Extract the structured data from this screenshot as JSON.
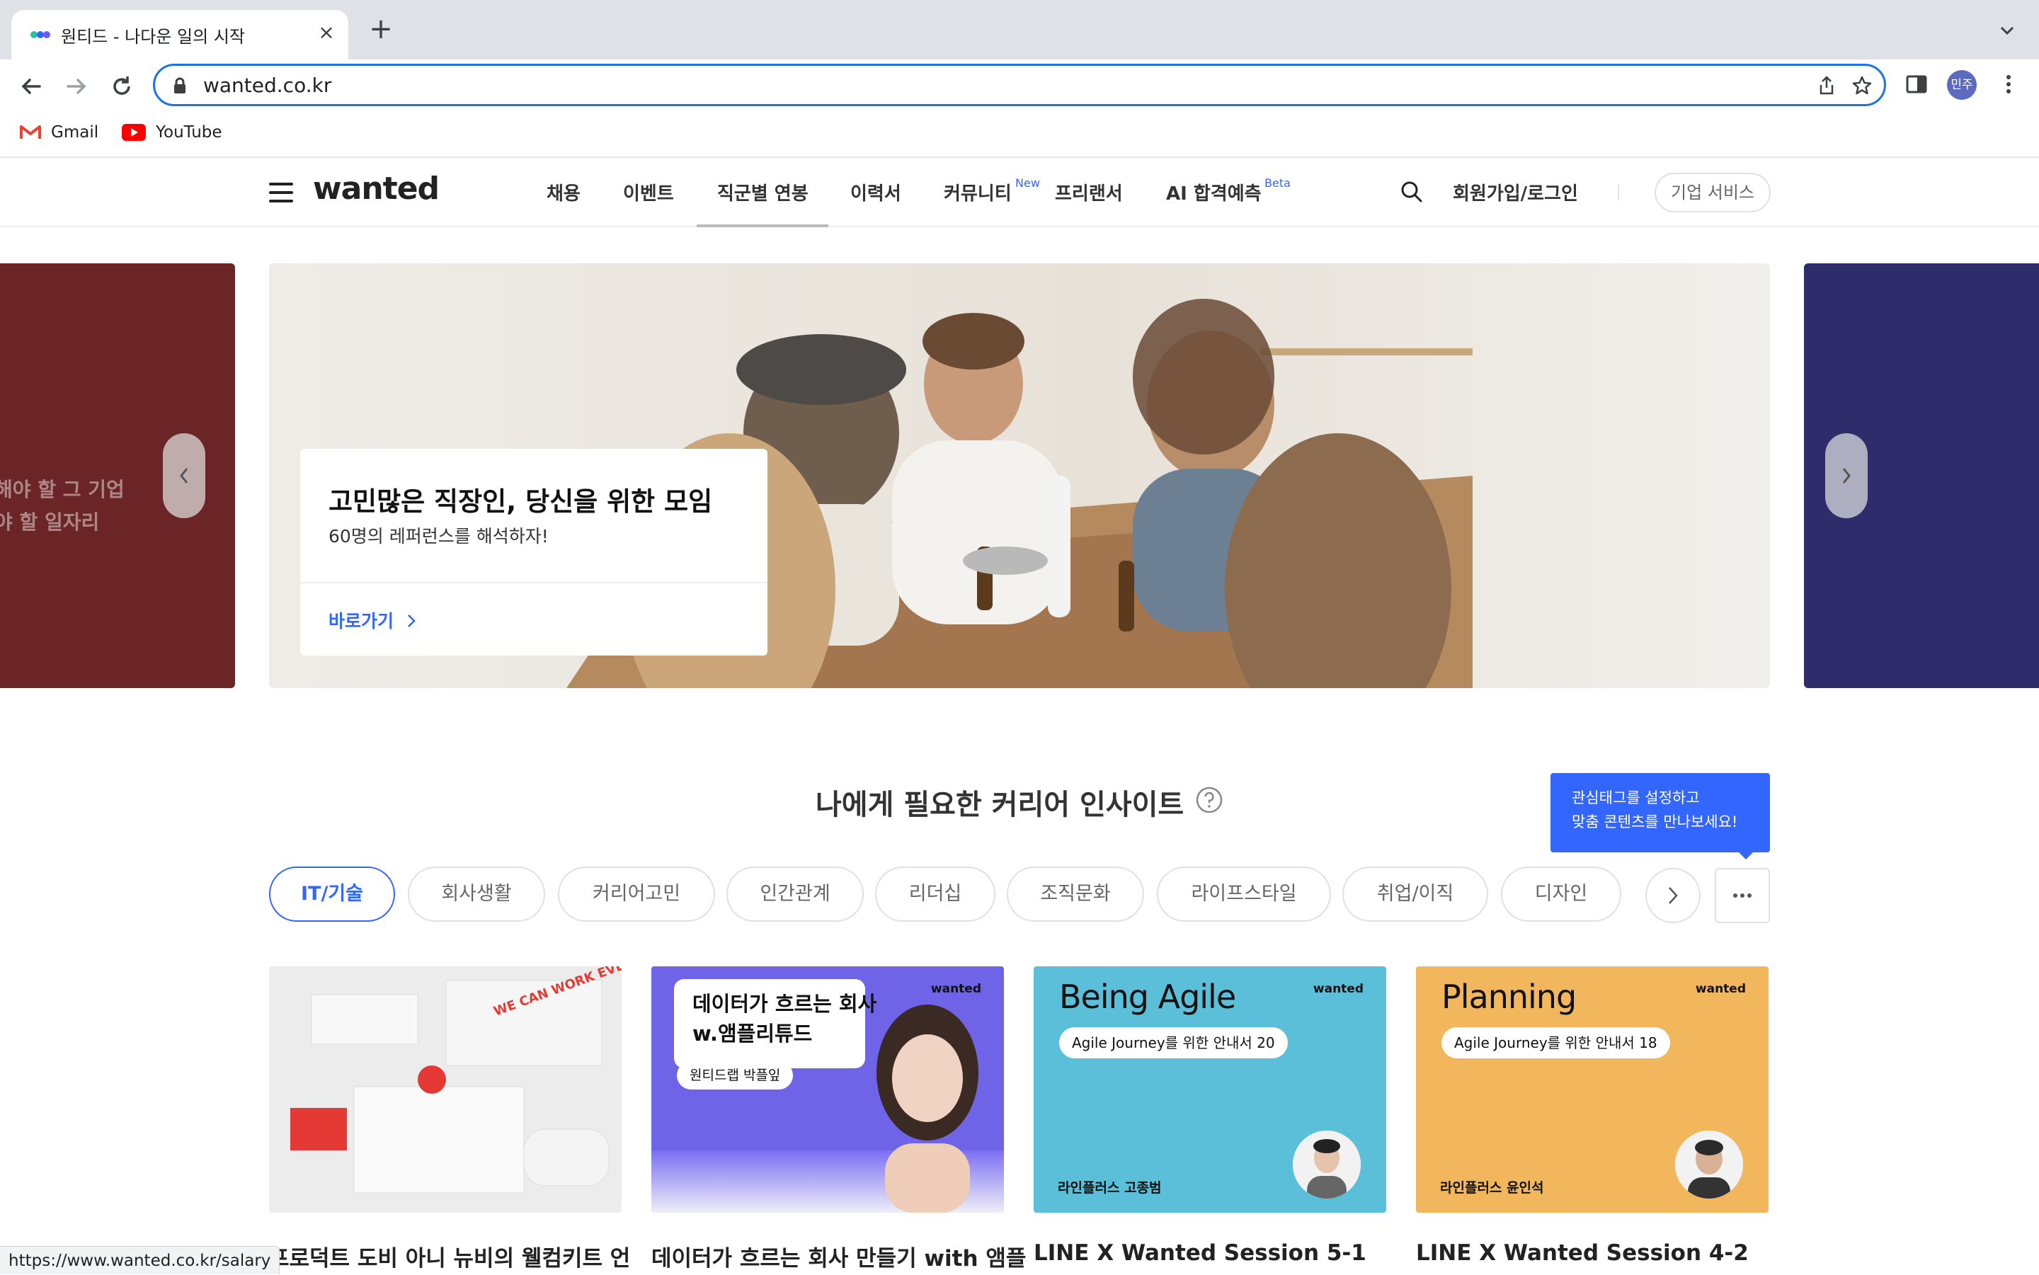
{
  "browser": {
    "tab_title": "원티드 - 나다운 일의 시작",
    "url": "wanted.co.kr",
    "profile_initials": "민주",
    "bookmarks": [
      {
        "label": "Gmail",
        "icon": "gmail-icon"
      },
      {
        "label": "YouTube",
        "icon": "youtube-icon"
      }
    ],
    "status_url": "https://www.wanted.co.kr/salary"
  },
  "site": {
    "logo": "wanted",
    "nav": [
      {
        "label": "채용"
      },
      {
        "label": "이벤트"
      },
      {
        "label": "직군별 연봉"
      },
      {
        "label": "이력서"
      },
      {
        "label": "커뮤니티",
        "badge": "New"
      },
      {
        "label": "프리랜서"
      },
      {
        "label": "AI 합격예측",
        "badge": "Beta"
      }
    ],
    "login": "회원가입/로그인",
    "business_button": "기업 서비스",
    "accent_color": "#3366ff"
  },
  "carousel": {
    "left_slide_lines": [
      "해야 할 그 기업",
      "야 할 일자리"
    ],
    "main_title": "고민많은 직장인, 당신을 위한 모임",
    "main_subtitle": "60명의 레퍼런스를 해석하자!",
    "main_link": "바로가기"
  },
  "insight": {
    "title": "나에게 필요한 커리어 인사이트",
    "tooltip": [
      "관심태그를 설정하고",
      "맞춤 콘텐츠를 만나보세요!"
    ],
    "tags": [
      "IT/기술",
      "회사생활",
      "커리어고민",
      "인간관계",
      "리더십",
      "조직문화",
      "라이프스타일",
      "취업/이직",
      "디자인"
    ],
    "active_tag": "IT/기술",
    "cards": [
      {
        "title": "프로덕트 도비 아니 뉴비의 웰컴키트 언",
        "image_text": "WE CAN WORK EVERYWHERE!"
      },
      {
        "title": "데이터가 흐르는 회사 만들기 with 앰플",
        "image_heading": [
          "데이터가 흐르는 회사",
          "w.앰플리튜드"
        ],
        "image_pill": "원티드랩 박플잎",
        "brand": "wanted"
      },
      {
        "title": "LINE X Wanted Session 5-1",
        "image_heading": "Being Agile",
        "image_pill": "Agile Journey를 위한 안내서 20",
        "author": "라인플러스 고종범",
        "brand": "wanted",
        "bg": "#5bbfd9"
      },
      {
        "title": "LINE X Wanted Session 4-2",
        "image_heading": "Planning",
        "image_pill": "Agile Journey를 위한 안내서 18",
        "author": "라인플러스 윤인석",
        "brand": "wanted",
        "bg": "#f2b65c"
      }
    ]
  }
}
